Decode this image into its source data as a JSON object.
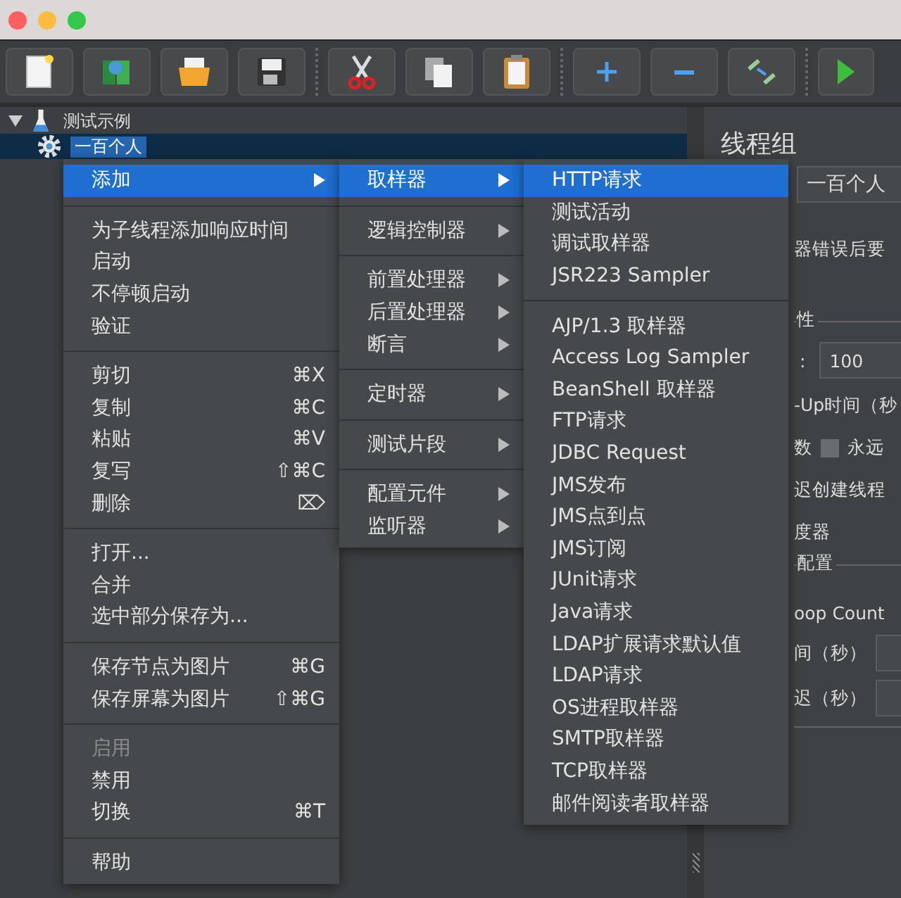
{
  "tree": {
    "items": [
      {
        "label": "测试示例",
        "expanded": true,
        "selected": false,
        "kind": "plan"
      },
      {
        "label": "一百个人",
        "selected": true,
        "kind": "thread"
      }
    ]
  },
  "detail_panel": {
    "title": "线程组",
    "name_value": "一百个人",
    "error_action": "器错误后要",
    "thread_props": "性",
    "threads_label": ":",
    "threads_value": "100",
    "ramp_up": "-Up时间（秒",
    "loop_label": "数",
    "loop_forever": {
      "label": "永远",
      "checked": false
    },
    "delay_create": "迟创建线程",
    "scheduler": "度器",
    "scheduler_config": "配置",
    "loop_count": "oop Count",
    "duration": "间（秒）",
    "startup_delay": "迟（秒）"
  },
  "menus": [
    {
      "groups": [
        [
          {
            "label": "添加",
            "submenu": true,
            "selected": true
          }
        ],
        [
          {
            "label": "为子线程添加响应时间"
          },
          {
            "label": "启动"
          },
          {
            "label": "不停顿启动"
          },
          {
            "label": "验证"
          }
        ],
        [
          {
            "label": "剪切",
            "shortcut": "⌘X"
          },
          {
            "label": "复制",
            "shortcut": "⌘C"
          },
          {
            "label": "粘贴",
            "shortcut": "⌘V"
          },
          {
            "label": "复写",
            "shortcut": "⇧⌘C"
          },
          {
            "label": "删除",
            "shortcut": "⌦"
          }
        ],
        [
          {
            "label": "打开..."
          },
          {
            "label": "合并"
          },
          {
            "label": "选中部分保存为..."
          }
        ],
        [
          {
            "label": "保存节点为图片",
            "shortcut": "⌘G"
          },
          {
            "label": "保存屏幕为图片",
            "shortcut": "⇧⌘G"
          }
        ],
        [
          {
            "label": "启用",
            "disabled": true
          },
          {
            "label": "禁用"
          },
          {
            "label": "切换",
            "shortcut": "⌘T"
          }
        ],
        [
          {
            "label": "帮助"
          }
        ]
      ]
    },
    {
      "groups": [
        [
          {
            "label": "取样器",
            "submenu": true,
            "selected": true
          }
        ],
        [
          {
            "label": "逻辑控制器",
            "submenu": true
          }
        ],
        [
          {
            "label": "前置处理器",
            "submenu": true
          },
          {
            "label": "后置处理器",
            "submenu": true
          },
          {
            "label": "断言",
            "submenu": true
          }
        ],
        [
          {
            "label": "定时器",
            "submenu": true
          }
        ],
        [
          {
            "label": "测试片段",
            "submenu": true
          }
        ],
        [
          {
            "label": "配置元件",
            "submenu": true
          },
          {
            "label": "监听器",
            "submenu": true
          }
        ]
      ]
    },
    {
      "groups": [
        [
          {
            "label": "HTTP请求",
            "selected": true
          },
          {
            "label": "测试活动"
          },
          {
            "label": "调试取样器"
          },
          {
            "label": "JSR223 Sampler"
          }
        ],
        [
          {
            "label": "AJP/1.3 取样器"
          },
          {
            "label": "Access Log Sampler"
          },
          {
            "label": "BeanShell 取样器"
          },
          {
            "label": "FTP请求"
          },
          {
            "label": "JDBC Request"
          },
          {
            "label": "JMS发布"
          },
          {
            "label": "JMS点到点"
          },
          {
            "label": "JMS订阅"
          },
          {
            "label": "JUnit请求"
          },
          {
            "label": "Java请求"
          },
          {
            "label": "LDAP扩展请求默认值"
          },
          {
            "label": "LDAP请求"
          },
          {
            "label": "OS进程取样器"
          },
          {
            "label": "SMTP取样器"
          },
          {
            "label": "TCP取样器"
          },
          {
            "label": "邮件阅读者取样器"
          }
        ]
      ]
    }
  ]
}
